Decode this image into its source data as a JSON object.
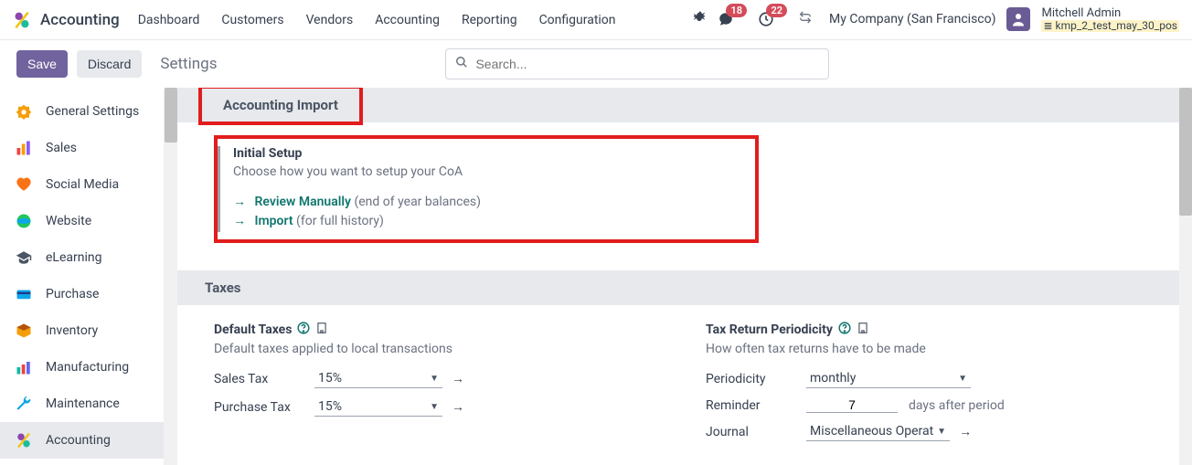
{
  "header": {
    "app": "Accounting",
    "menus": [
      "Dashboard",
      "Customers",
      "Vendors",
      "Accounting",
      "Reporting",
      "Configuration"
    ],
    "chat_badge": "18",
    "clock_badge": "22",
    "company": "My Company (San Francisco)",
    "user_name": "Mitchell Admin",
    "db_name": "kmp_2_test_may_30_pos"
  },
  "actions": {
    "save": "Save",
    "discard": "Discard",
    "view_title": "Settings",
    "search_placeholder": "Search..."
  },
  "sidebar": {
    "items": [
      {
        "label": "General Settings"
      },
      {
        "label": "Sales"
      },
      {
        "label": "Social Media"
      },
      {
        "label": "Website"
      },
      {
        "label": "eLearning"
      },
      {
        "label": "Purchase"
      },
      {
        "label": "Inventory"
      },
      {
        "label": "Manufacturing"
      },
      {
        "label": "Maintenance"
      },
      {
        "label": "Accounting"
      }
    ]
  },
  "sections": {
    "import": {
      "title": "Accounting Import",
      "setup_title": "Initial Setup",
      "setup_desc": "Choose how you want to setup your CoA",
      "review_link": "Review Manually",
      "review_hint": "(end of year balances)",
      "import_link": "Import",
      "import_hint": "(for full history)"
    },
    "taxes": {
      "title": "Taxes",
      "default_taxes": {
        "title": "Default Taxes",
        "desc": "Default taxes applied to local transactions",
        "sales_label": "Sales Tax",
        "sales_value": "15%",
        "purchase_label": "Purchase Tax",
        "purchase_value": "15%"
      },
      "periodicity": {
        "title": "Tax Return Periodicity",
        "desc": "How often tax returns have to be made",
        "periodicity_label": "Periodicity",
        "periodicity_value": "monthly",
        "reminder_label": "Reminder",
        "reminder_value": "7",
        "reminder_suffix": "days after period",
        "journal_label": "Journal",
        "journal_value": "Miscellaneous Operat"
      }
    }
  }
}
